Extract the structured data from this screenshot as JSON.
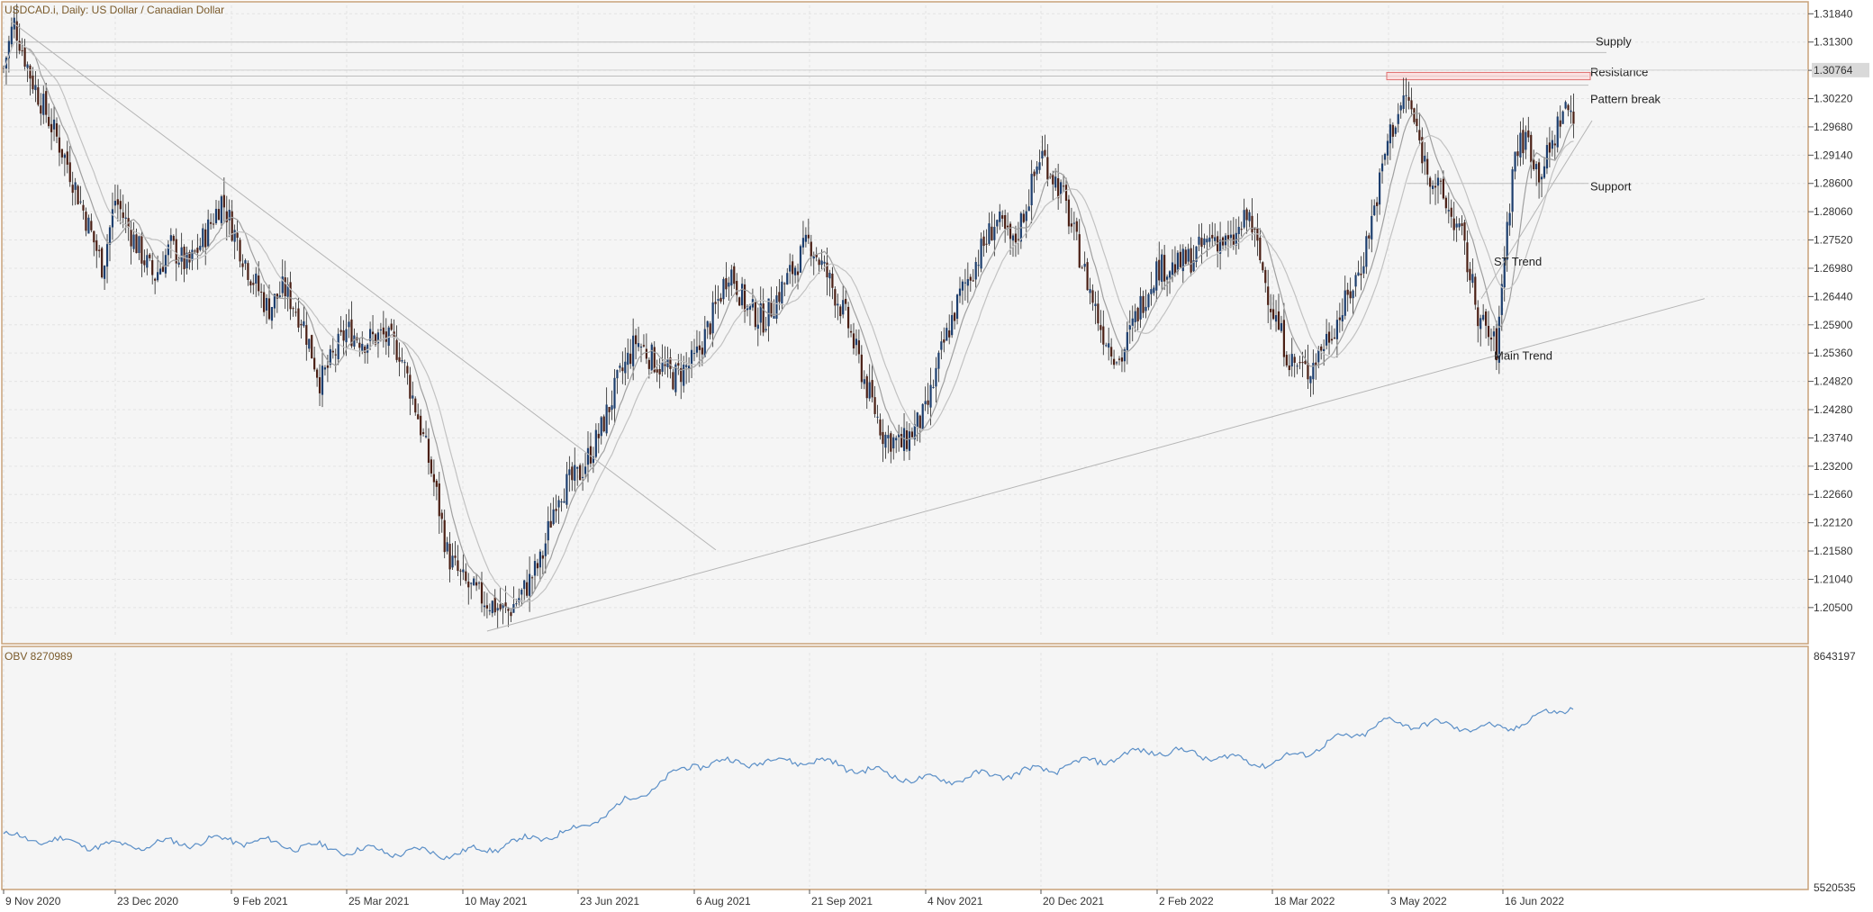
{
  "window": {
    "symbol_title": "USDCAD.i, Daily:  US Dollar / Canadian Dollar",
    "indicator_title": "OBV 8270989"
  },
  "colors": {
    "background": "#f5f5f5",
    "frame": "#c8a27a",
    "bull_candle": "#1c3e6e",
    "bear_candle": "#4a1f14",
    "ma_line": "#9a9a9a",
    "obv_line": "#5b8fc7",
    "resistance_box": "#e07070",
    "trendline": "#b5b5b5"
  },
  "chart_data": [
    {
      "type": "candlestick",
      "title": "USDCAD.i, Daily:  US Dollar / Canadian Dollar",
      "price_axis_ticks": [
        "1.31840",
        "1.31300",
        "1.30760",
        "1.30220",
        "1.29680",
        "1.29140",
        "1.28600",
        "1.28060",
        "1.27520",
        "1.26980",
        "1.26440",
        "1.25900",
        "1.25360",
        "1.24820",
        "1.24280",
        "1.23740",
        "1.23200",
        "1.22660",
        "1.22120",
        "1.21580",
        "1.21040",
        "1.20500"
      ],
      "current_price": "1.30764",
      "ylim": [
        1.1993,
        1.32
      ],
      "date_ticks": [
        "9 Nov 2020",
        "23 Dec 2020",
        "9 Feb 2021",
        "25 Mar 2021",
        "10 May 2021",
        "23 Jun 2021",
        "6 Aug 2021",
        "21 Sep 2021",
        "4 Nov 2021",
        "20 Dec 2021",
        "2 Feb 2022",
        "18 Mar 2022",
        "3 May 2022",
        "16 Jun 2022"
      ],
      "close_path": [
        [
          "9 Nov 2020",
          1.308
        ],
        [
          "13 Nov 2020",
          1.317
        ],
        [
          "20 Nov 2020",
          1.306
        ],
        [
          "27 Nov 2020",
          1.298
        ],
        [
          "4 Dec 2020",
          1.29
        ],
        [
          "11 Dec 2020",
          1.28
        ],
        [
          "18 Dec 2020",
          1.27
        ],
        [
          "23 Dec 2020",
          1.283
        ],
        [
          "31 Dec 2020",
          1.275
        ],
        [
          "8 Jan 2021",
          1.268
        ],
        [
          "15 Jan 2021",
          1.274
        ],
        [
          "22 Jan 2021",
          1.27
        ],
        [
          "29 Jan 2021",
          1.276
        ],
        [
          "5 Feb 2021",
          1.283
        ],
        [
          "9 Feb 2021",
          1.278
        ],
        [
          "16 Feb 2021",
          1.269
        ],
        [
          "23 Feb 2021",
          1.262
        ],
        [
          "1 Mar 2021",
          1.266
        ],
        [
          "8 Mar 2021",
          1.26
        ],
        [
          "15 Mar 2021",
          1.248
        ],
        [
          "19 Mar 2021",
          1.252
        ],
        [
          "25 Mar 2021",
          1.258
        ],
        [
          "1 Apr 2021",
          1.256
        ],
        [
          "8 Apr 2021",
          1.257
        ],
        [
          "15 Apr 2021",
          1.254
        ],
        [
          "22 Apr 2021",
          1.242
        ],
        [
          "29 Apr 2021",
          1.228
        ],
        [
          "4 May 2021",
          1.215
        ],
        [
          "10 May 2021",
          1.21
        ],
        [
          "14 May 2021",
          1.208
        ],
        [
          "20 May 2021",
          1.206
        ],
        [
          "27 May 2021",
          1.204
        ],
        [
          "2 Jun 2021",
          1.208
        ],
        [
          "9 Jun 2021",
          1.214
        ],
        [
          "15 Jun 2021",
          1.227
        ],
        [
          "23 Jun 2021",
          1.23
        ],
        [
          "1 Jul 2021",
          1.238
        ],
        [
          "8 Jul 2021",
          1.248
        ],
        [
          "15 Jul 2021",
          1.256
        ],
        [
          "22 Jul 2021",
          1.252
        ],
        [
          "29 Jul 2021",
          1.249
        ],
        [
          "6 Aug 2021",
          1.252
        ],
        [
          "13 Aug 2021",
          1.26
        ],
        [
          "20 Aug 2021",
          1.27
        ],
        [
          "27 Aug 2021",
          1.262
        ],
        [
          "3 Sep 2021",
          1.26
        ],
        [
          "10 Sep 2021",
          1.266
        ],
        [
          "21 Sep 2021",
          1.275
        ],
        [
          "28 Sep 2021",
          1.268
        ],
        [
          "5 Oct 2021",
          1.26
        ],
        [
          "12 Oct 2021",
          1.248
        ],
        [
          "19 Oct 2021",
          1.238
        ],
        [
          "26 Oct 2021",
          1.236
        ],
        [
          "4 Nov 2021",
          1.242
        ],
        [
          "11 Nov 2021",
          1.255
        ],
        [
          "18 Nov 2021",
          1.265
        ],
        [
          "25 Nov 2021",
          1.272
        ],
        [
          "2 Dec 2021",
          1.279
        ],
        [
          "9 Dec 2021",
          1.274
        ],
        [
          "16 Dec 2021",
          1.285
        ],
        [
          "20 Dec 2021",
          1.292
        ],
        [
          "28 Dec 2021",
          1.284
        ],
        [
          "5 Jan 2022",
          1.27
        ],
        [
          "12 Jan 2022",
          1.258
        ],
        [
          "19 Jan 2022",
          1.252
        ],
        [
          "26 Jan 2022",
          1.262
        ],
        [
          "2 Feb 2022",
          1.27
        ],
        [
          "9 Feb 2022",
          1.27
        ],
        [
          "16 Feb 2022",
          1.272
        ],
        [
          "23 Feb 2022",
          1.276
        ],
        [
          "2 Mar 2022",
          1.274
        ],
        [
          "9 Mar 2022",
          1.28
        ],
        [
          "18 Mar 2022",
          1.262
        ],
        [
          "25 Mar 2022",
          1.252
        ],
        [
          "1 Apr 2022",
          1.25
        ],
        [
          "8 Apr 2022",
          1.256
        ],
        [
          "15 Apr 2022",
          1.262
        ],
        [
          "22 Apr 2022",
          1.27
        ],
        [
          "29 Apr 2022",
          1.285
        ],
        [
          "3 May 2022",
          1.295
        ],
        [
          "10 May 2022",
          1.303
        ],
        [
          "17 May 2022",
          1.29
        ],
        [
          "24 May 2022",
          1.283
        ],
        [
          "31 May 2022",
          1.276
        ],
        [
          "7 Jun 2022",
          1.26
        ],
        [
          "14 Jun 2022",
          1.254
        ],
        [
          "16 Jun 2022",
          1.27
        ],
        [
          "23 Jun 2022",
          1.292
        ],
        [
          "30 Jun 2022",
          1.295
        ],
        [
          "7 Jul 2022",
          1.288
        ],
        [
          "14 Jul 2022",
          1.292
        ],
        [
          "21 Jul 2022",
          1.3
        ],
        [
          "28 Jul 2022",
          1.3
        ]
      ],
      "levels": {
        "supply": [
          1.311,
          1.313
        ],
        "resistance_zone": [
          1.3058,
          1.3072
        ],
        "support": 1.286
      },
      "annotations": [
        {
          "text": "Supply",
          "date": "28 Jul 2022",
          "price": 1.313
        },
        {
          "text": "Resistance",
          "date": "28 Jul 2022",
          "price": 1.3072
        },
        {
          "text": "Pattern break",
          "date": "28 Jul 2022",
          "price": 1.302
        },
        {
          "text": "Support",
          "date": "28 Jul 2022",
          "price": 1.286
        },
        {
          "text": "ST Trend",
          "date": "16 Jun 2022",
          "price": 1.271
        },
        {
          "text": "Main Trend",
          "date": "16 Jun 2022",
          "price": 1.253
        }
      ]
    },
    {
      "type": "line",
      "title": "OBV 8270989",
      "y_axis_ticks": [
        "8643197",
        "5520535"
      ],
      "ylim": [
        5520535,
        8643197
      ],
      "obv_path": [
        [
          "9 Nov 2020",
          6250000
        ],
        [
          "23 Dec 2020",
          6100000
        ],
        [
          "9 Feb 2021",
          6200000
        ],
        [
          "25 Mar 2021",
          6050000
        ],
        [
          "10 May 2021",
          6000000
        ],
        [
          "23 Jun 2021",
          6350000
        ],
        [
          "6 Aug 2021",
          7300000
        ],
        [
          "21 Sep 2021",
          7350000
        ],
        [
          "4 Nov 2021",
          7050000
        ],
        [
          "20 Dec 2021",
          7200000
        ],
        [
          "2 Feb 2022",
          7500000
        ],
        [
          "18 Mar 2022",
          7300000
        ],
        [
          "3 May 2022",
          7900000
        ],
        [
          "16 Jun 2022",
          7800000
        ],
        [
          "28 Jul 2022",
          8150000
        ]
      ]
    }
  ]
}
